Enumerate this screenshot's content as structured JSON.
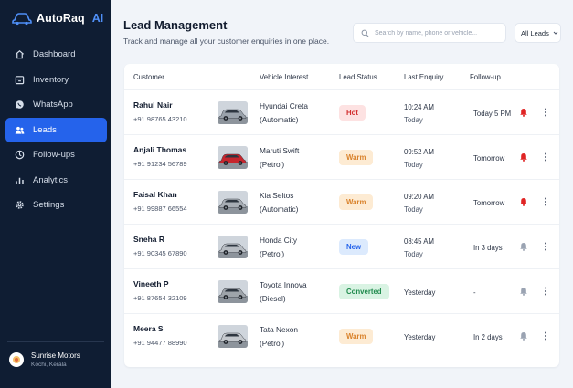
{
  "brand": {
    "name": "AutoRaq",
    "suffix": "AI"
  },
  "sidebar": {
    "items": [
      {
        "label": "Dashboard",
        "icon": "home-icon",
        "active": false
      },
      {
        "label": "Inventory",
        "icon": "inventory-icon",
        "active": false
      },
      {
        "label": "WhatsApp",
        "icon": "whatsapp-icon",
        "active": false
      },
      {
        "label": "Leads",
        "icon": "users-icon",
        "active": true
      },
      {
        "label": "Follow-ups",
        "icon": "clock-icon",
        "active": false
      },
      {
        "label": "Analytics",
        "icon": "analytics-icon",
        "active": false
      },
      {
        "label": "Settings",
        "icon": "gear-icon",
        "active": false
      }
    ],
    "account": {
      "name": "Sunrise Motors",
      "location": "Kochi, Kerala"
    }
  },
  "header": {
    "title": "Lead Management",
    "subtitle": "Track and manage all your customer enquiries in one place.",
    "search_placeholder": "Search by name, phone or vehicle...",
    "filter_label": "All Leads"
  },
  "table": {
    "columns": [
      "Customer",
      "Vehicle Interest",
      "Lead Status",
      "Last Enquiry",
      "Follow-up"
    ],
    "rows": [
      {
        "name": "Rahul Nair",
        "phone": "+91 98765 43210",
        "vehicle": "Hyundai Creta",
        "variant": "(Automatic)",
        "status": "Hot",
        "enquiry_time": "10:24 AM",
        "enquiry_day": "Today",
        "followup": "Today 5 PM",
        "bell": "active",
        "car_color": "#9aa2ab"
      },
      {
        "name": "Anjali Thomas",
        "phone": "+91 91234 56789",
        "vehicle": "Maruti Swift",
        "variant": "(Petrol)",
        "status": "Warm",
        "enquiry_time": "09:52 AM",
        "enquiry_day": "Today",
        "followup": "Tomorrow",
        "bell": "active",
        "car_color": "#c6262e"
      },
      {
        "name": "Faisal Khan",
        "phone": "+91 99887 66554",
        "vehicle": "Kia Seltos",
        "variant": "(Automatic)",
        "status": "Warm",
        "enquiry_time": "09:20 AM",
        "enquiry_day": "Today",
        "followup": "Tomorrow",
        "bell": "active",
        "car_color": "#a7adb4"
      },
      {
        "name": "Sneha R",
        "phone": "+91 90345 67890",
        "vehicle": "Honda City",
        "variant": "(Petrol)",
        "status": "New",
        "enquiry_time": "08:45 AM",
        "enquiry_day": "Today",
        "followup": "In 3 days",
        "bell": "muted",
        "car_color": "#b7bcc2"
      },
      {
        "name": "Vineeth P",
        "phone": "+91 87654 32109",
        "vehicle": "Toyota Innova",
        "variant": "(Diesel)",
        "status": "Converted",
        "enquiry_time": "",
        "enquiry_day": "Yesterday",
        "followup": "-",
        "bell": "muted",
        "car_color": "#9ea4aa"
      },
      {
        "name": "Meera S",
        "phone": "+91 94477 88990",
        "vehicle": "Tata Nexon",
        "variant": "(Petrol)",
        "status": "Warm",
        "enquiry_time": "",
        "enquiry_day": "Yesterday",
        "followup": "In 2 days",
        "bell": "muted",
        "car_color": "#c4c8cd"
      }
    ]
  },
  "status_colors": {
    "Hot": {
      "bg": "#fde2e2",
      "fg": "#d32f2f"
    },
    "Warm": {
      "bg": "#fdebd3",
      "fg": "#d9822b"
    },
    "New": {
      "bg": "#dceafd",
      "fg": "#2563eb"
    },
    "Converted": {
      "bg": "#d9f3e3",
      "fg": "#1f8a4c"
    }
  },
  "colors": {
    "accent": "#2563eb",
    "sidebar_bg": "#0f1d33",
    "bell_active": "#e02424",
    "bell_muted": "#9aa3b2"
  }
}
